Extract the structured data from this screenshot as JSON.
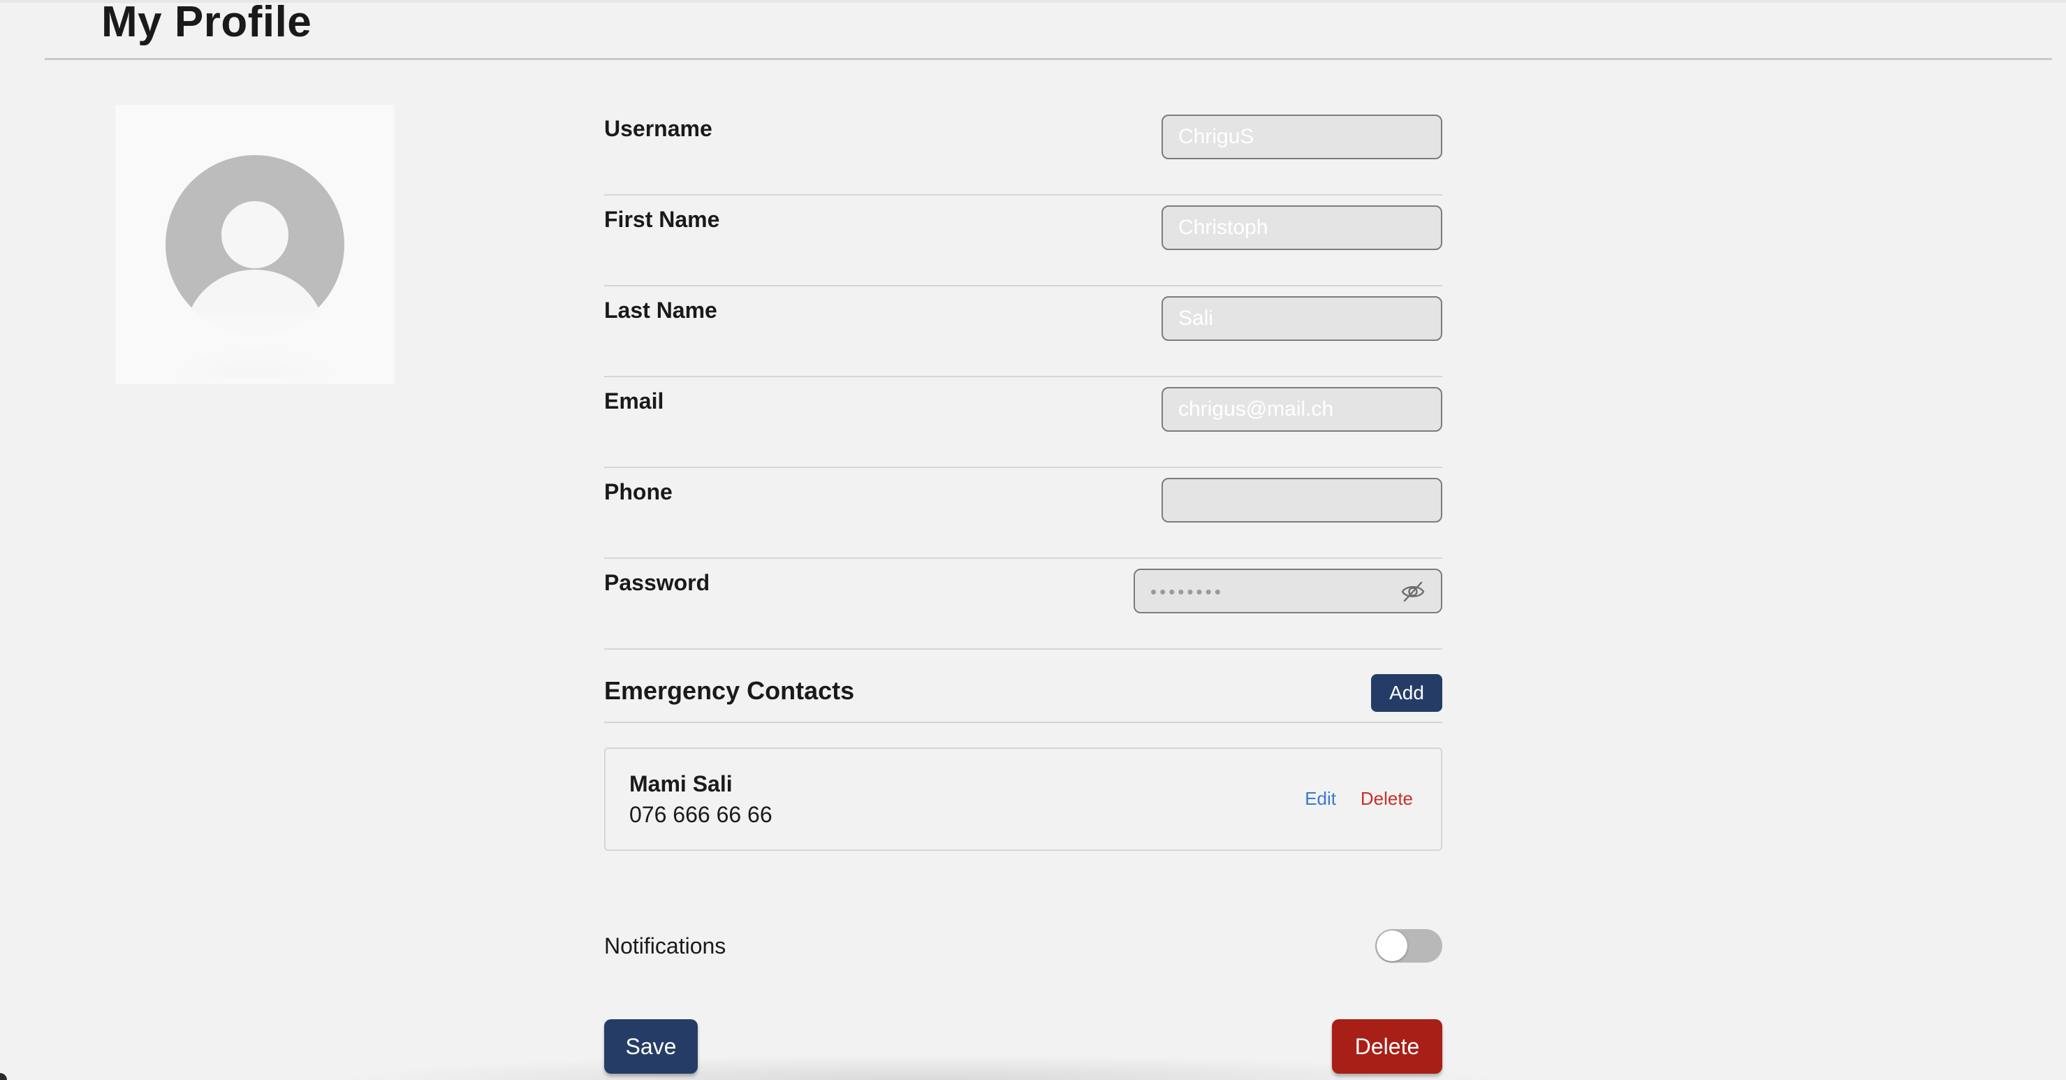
{
  "page": {
    "title": "My Profile"
  },
  "avatar": {
    "icon": "user-avatar-icon"
  },
  "fields": [
    {
      "label": "Username",
      "value": "ChriguS",
      "placeholder": ""
    },
    {
      "label": "First Name",
      "value": "Christoph",
      "placeholder": ""
    },
    {
      "label": "Last Name",
      "value": "Sali",
      "placeholder": ""
    },
    {
      "label": "Email",
      "value": "chrigus@mail.ch",
      "placeholder": ""
    },
    {
      "label": "Phone",
      "value": "",
      "placeholder": ""
    },
    {
      "label": "Password",
      "value": "••••••••",
      "icon": "eye-off-icon"
    }
  ],
  "emergency_contacts": {
    "title": "Emergency Contacts",
    "add_label": "Add",
    "items": [
      {
        "name": "Mami Sali",
        "phone": "076 666 66 66",
        "edit_label": "Edit",
        "delete_label": "Delete"
      }
    ]
  },
  "notifications": {
    "label": "Notifications",
    "enabled": false
  },
  "actions": {
    "save_label": "Save",
    "delete_label": "Delete"
  },
  "colors": {
    "primary": "#253d66",
    "danger": "#a81f17",
    "link_edit": "#3a78cf",
    "link_delete": "#c4322b",
    "background": "#f2f2f2"
  }
}
